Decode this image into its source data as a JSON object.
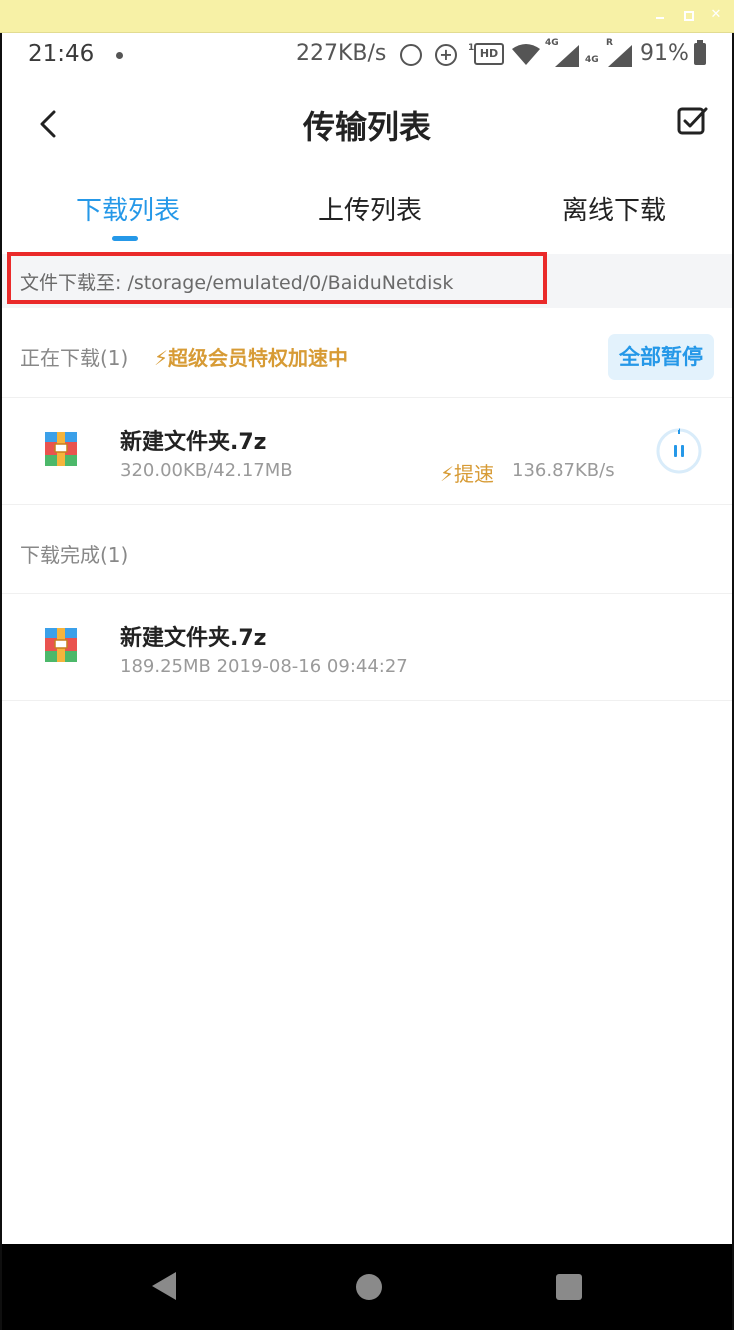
{
  "status_bar": {
    "time": "21:46",
    "net_speed": "227KB/s",
    "hd_label": "HD",
    "hd_sup": "1",
    "network_1": "4G",
    "network_2": "4G",
    "roaming": "R",
    "battery": "91%"
  },
  "header": {
    "title": "传输列表"
  },
  "tabs": [
    {
      "label": "下载列表",
      "active": true
    },
    {
      "label": "上传列表",
      "active": false
    },
    {
      "label": "离线下载",
      "active": false
    }
  ],
  "path_bar": {
    "text": "文件下载至: /storage/emulated/0/BaiduNetdisk"
  },
  "downloading": {
    "title": "正在下载(1)",
    "vip_text": "超级会员特权加速中",
    "pause_all_label": "全部暂停",
    "items": [
      {
        "name": "新建文件夹.7z",
        "progress": "320.00KB/42.17MB",
        "speedup_label": "提速",
        "speed": "136.87KB/s"
      }
    ]
  },
  "completed": {
    "title": "下载完成(1)",
    "items": [
      {
        "name": "新建文件夹.7z",
        "meta": "189.25MB 2019-08-16 09:44:27"
      }
    ]
  },
  "colors": {
    "accent": "#2598e8",
    "vip": "#d79b35",
    "highlight": "#ea2a2a"
  }
}
